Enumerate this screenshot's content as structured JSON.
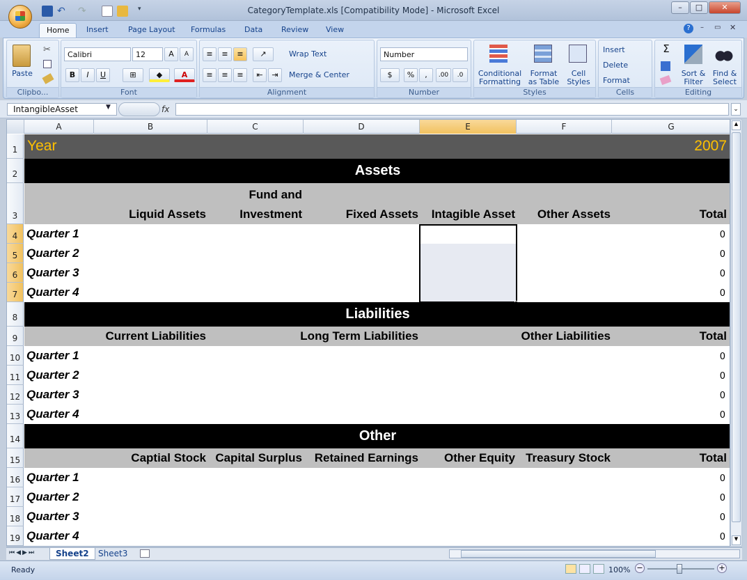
{
  "window": {
    "title": "CategoryTemplate.xls  [Compatibility Mode] - Microsoft Excel",
    "min": "–",
    "max": "□",
    "close": "✕"
  },
  "tabs": [
    "Home",
    "Insert",
    "Page Layout",
    "Formulas",
    "Data",
    "Review",
    "View"
  ],
  "ribbon": {
    "clipboard": {
      "paste": "Paste",
      "label": "Clipbo..."
    },
    "font": {
      "family": "Calibri",
      "size": "12",
      "label": "Font",
      "bold": "B",
      "italic": "I",
      "underline": "U"
    },
    "alignment": {
      "wrap": "Wrap Text",
      "merge": "Merge & Center",
      "label": "Alignment"
    },
    "number": {
      "format": "Number",
      "currency": "$",
      "percent": "%",
      "comma": ",",
      "inc": ".00",
      "dec": ".0",
      "label": "Number"
    },
    "styles": {
      "conditional": "Conditional Formatting",
      "format_table": "Format as Table",
      "cell_styles": "Cell Styles",
      "label": "Styles"
    },
    "cells": {
      "insert": "Insert",
      "delete": "Delete",
      "format": "Format",
      "label": "Cells"
    },
    "editing": {
      "sum": "Σ",
      "sort": "Sort & Filter",
      "find": "Find & Select",
      "label": "Editing"
    }
  },
  "formula_bar": {
    "name_box": "IntangibleAsset",
    "fx": "fx",
    "formula": ""
  },
  "columns": [
    "A",
    "B",
    "C",
    "D",
    "E",
    "F",
    "G"
  ],
  "rows": [
    "1",
    "2",
    "3",
    "4",
    "5",
    "6",
    "7",
    "8",
    "9",
    "10",
    "11",
    "12",
    "13",
    "14",
    "15",
    "16",
    "17",
    "18",
    "19"
  ],
  "sheet": {
    "year_label": "Year",
    "year_value": "2007",
    "assets": {
      "title": "Assets",
      "headers": [
        "Liquid Assets",
        "Fund and",
        "Investment",
        "Fixed Assets",
        "Intagible Asset",
        "Other Assets",
        "Total"
      ],
      "quarters": [
        "Quarter 1",
        "Quarter 2",
        "Quarter 3",
        "Quarter 4"
      ],
      "totals": [
        "0",
        "0",
        "0",
        "0"
      ]
    },
    "liabilities": {
      "title": "Liabilities",
      "headers": [
        "Current Liabilities",
        "Long Term Liabilities",
        "Other Liabilities",
        "Total"
      ],
      "quarters": [
        "Quarter 1",
        "Quarter 2",
        "Quarter 3",
        "Quarter 4"
      ],
      "totals": [
        "0",
        "0",
        "0",
        "0"
      ]
    },
    "other": {
      "title": "Other",
      "headers": [
        "Captial Stock",
        "Capital Surplus",
        "Retained Earnings",
        "Other Equity",
        "Treasury Stock",
        "Total"
      ],
      "quarters": [
        "Quarter 1",
        "Quarter 2",
        "Quarter 3",
        "Quarter 4"
      ],
      "totals": [
        "0",
        "0",
        "0",
        "0"
      ]
    }
  },
  "sheet_tabs": [
    "Sheet2",
    "Sheet3"
  ],
  "status": {
    "ready": "Ready",
    "zoom": "100%"
  },
  "colors": {
    "year_band": "#595959",
    "year_text": "#ffc000",
    "section_band": "#000000",
    "header_band": "#bfbfbf",
    "selection": "#e7eaf2"
  }
}
